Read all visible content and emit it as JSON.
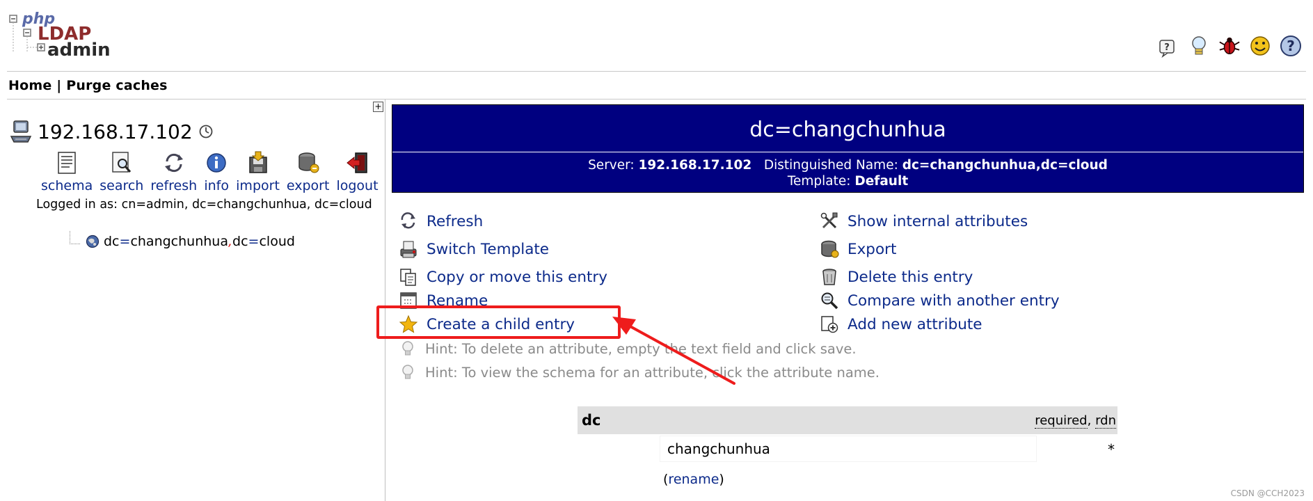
{
  "header": {
    "logo": {
      "line1": "php",
      "line2": "LDAP",
      "line3": "admin"
    },
    "icons": [
      "help-icon",
      "hint-bulb-icon",
      "bug-icon",
      "smiley-icon",
      "question-icon"
    ]
  },
  "nav": {
    "home": "Home",
    "separator": "|",
    "purge": "Purge caches"
  },
  "server": {
    "name": "192.168.17.102",
    "tools": {
      "schema": "schema",
      "search": "search",
      "refresh": "refresh",
      "info": "info",
      "import": "import",
      "export": "export",
      "logout": "logout"
    },
    "logged_in": "Logged in as: cn=admin, dc=changchunhua, dc=cloud"
  },
  "tree": {
    "attr1": "dc",
    "eq1": "=",
    "val1": "changchunhua",
    "comma": ",",
    "attr2": "dc",
    "eq2": "=",
    "val2": "cloud"
  },
  "entry": {
    "title": "dc=changchunhua",
    "server_label": "Server:",
    "server_value": "192.168.17.102",
    "dn_label": "Distinguished Name:",
    "dn_value": "dc=changchunhua,dc=cloud",
    "template_label": "Template:",
    "template_value": "Default"
  },
  "actions": {
    "refresh": "Refresh",
    "switch_template": "Switch Template",
    "copy_move": "Copy or move this entry",
    "rename": "Rename",
    "create_child": "Create a child entry",
    "show_internal": "Show internal attributes",
    "export": "Export",
    "delete": "Delete this entry",
    "compare": "Compare with another entry",
    "add_attribute": "Add new attribute"
  },
  "hints": {
    "delete_hint": "Hint: To delete an attribute, empty the text field and click save.",
    "schema_hint": "Hint: To view the schema for an attribute, click the attribute name."
  },
  "attribute": {
    "name": "dc",
    "flag_required": "required",
    "flag_sep": ",",
    "flag_rdn": "rdn",
    "value": "changchunhua",
    "required_marker": "*",
    "rename_open": "(",
    "rename_link": "rename",
    "rename_close": ")"
  },
  "watermark": "CSDN @CCH2023",
  "colors": {
    "title_bg": "#000080",
    "link": "#0c2a8a",
    "highlight": "#ee1c1c",
    "attr_header_bg": "#e0e0e0"
  }
}
